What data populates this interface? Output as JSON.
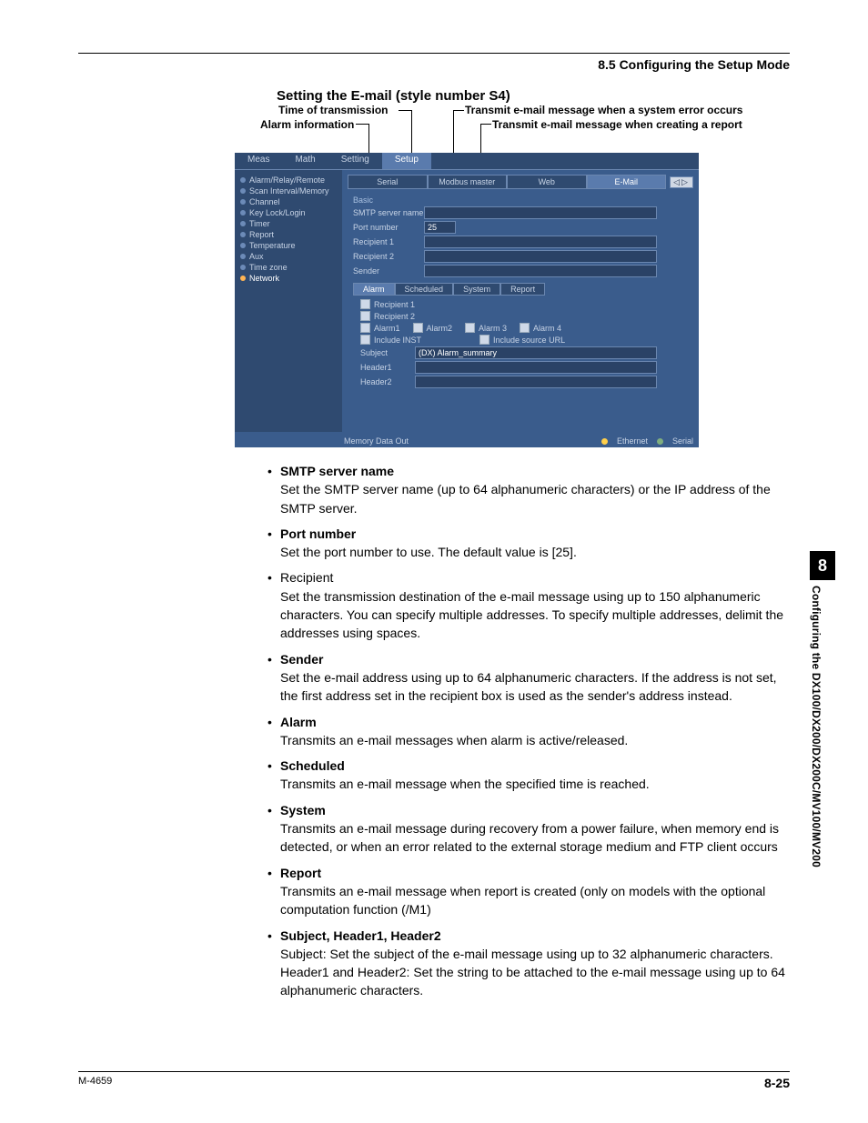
{
  "header": {
    "section": "8.5  Configuring the Setup Mode"
  },
  "title": "Setting the E-mail (style number S4)",
  "annotations": {
    "time_of_transmission": "Time of transmission",
    "alarm_information": "Alarm information",
    "system_error": "Transmit e-mail message when a system error occurs",
    "report": "Transmit e-mail message when creating a report"
  },
  "screenshot": {
    "topbar": {
      "items": [
        "Meas",
        "Math",
        "Setting",
        "Setup"
      ],
      "selected_index": 3
    },
    "sidebar": {
      "items": [
        "Alarm/Relay/Remote",
        "Scan Interval/Memory",
        "Channel",
        "Key Lock/Login",
        "Timer",
        "Report",
        "Temperature",
        "Aux",
        "Time zone",
        "Network"
      ],
      "active_index": 9
    },
    "subtabs": {
      "items": [
        "Serial",
        "Modbus master",
        "Web",
        "E-Mail"
      ],
      "selected_index": 3
    },
    "nav_arrows": "◁▷",
    "basic": {
      "group": "Basic",
      "smtp_label": "SMTP server name",
      "smtp_value": "",
      "port_label": "Port number",
      "port_value": "25",
      "recip1_label": "Recipient 1",
      "recip1_value": "",
      "recip2_label": "Recipient 2",
      "recip2_value": "",
      "sender_label": "Sender",
      "sender_value": ""
    },
    "mode_tabs": {
      "items": [
        "Alarm",
        "Scheduled",
        "System",
        "Report"
      ],
      "selected_index": 0
    },
    "alarm_opts": {
      "recipient1": "Recipient 1",
      "recipient2": "Recipient 2",
      "alarms": [
        "Alarm1",
        "Alarm2",
        "Alarm 3",
        "Alarm 4"
      ],
      "include_inst": "Include INST",
      "include_src": "Include source URL",
      "subject_label": "Subject",
      "subject_value": "(DX) Alarm_summary",
      "header1_label": "Header1",
      "header1_value": "",
      "header2_label": "Header2",
      "header2_value": ""
    },
    "status": {
      "memout": "Memory Data Out",
      "eth": "Ethernet",
      "ser": "Serial"
    }
  },
  "items": [
    {
      "head": "SMTP server name",
      "bold": true,
      "body": "Set the SMTP server name (up to 64 alphanumeric characters) or the IP address of the SMTP server."
    },
    {
      "head": "Port number",
      "bold": true,
      "body": "Set the port number to use.  The default value is [25]."
    },
    {
      "head": "Recipient",
      "bold": false,
      "body": "Set the transmission destination of the e-mail message using up to 150 alphanumeric characters.  You can specify multiple addresses.  To specify multiple addresses, delimit the addresses using spaces."
    },
    {
      "head": "Sender",
      "bold": true,
      "body": "Set the e-mail address using up to 64 alphanumeric characters.  If the address is not set, the first address set in the recipient box is used as the sender's address instead."
    },
    {
      "head": "Alarm",
      "bold": true,
      "body": "Transmits an e-mail messages when alarm is active/released."
    },
    {
      "head": "Scheduled",
      "bold": true,
      "body": "Transmits an e-mail message when the specified time is reached."
    },
    {
      "head": "System",
      "bold": true,
      "body": "Transmits an e-mail message during recovery from a power failure, when memory end is detected, or when an error related to the external storage medium and FTP client occurs"
    },
    {
      "head": "Report",
      "bold": true,
      "body": "Transmits an e-mail message when report is created (only on models with the optional computation function (/M1)"
    },
    {
      "head": "Subject, Header1, Header2",
      "bold": true,
      "body": "Subject: Set the subject of the e-mail message using up to 32 alphanumeric characters.\nHeader1 and Header2: Set the string to be attached to the e-mail message using up to 64 alphanumeric characters."
    }
  ],
  "sidetab": {
    "num": "8",
    "text": "Configuring the DX100/DX200/DX200C/MV100/MV200"
  },
  "footer": {
    "left": "M-4659",
    "right": "8-25"
  }
}
